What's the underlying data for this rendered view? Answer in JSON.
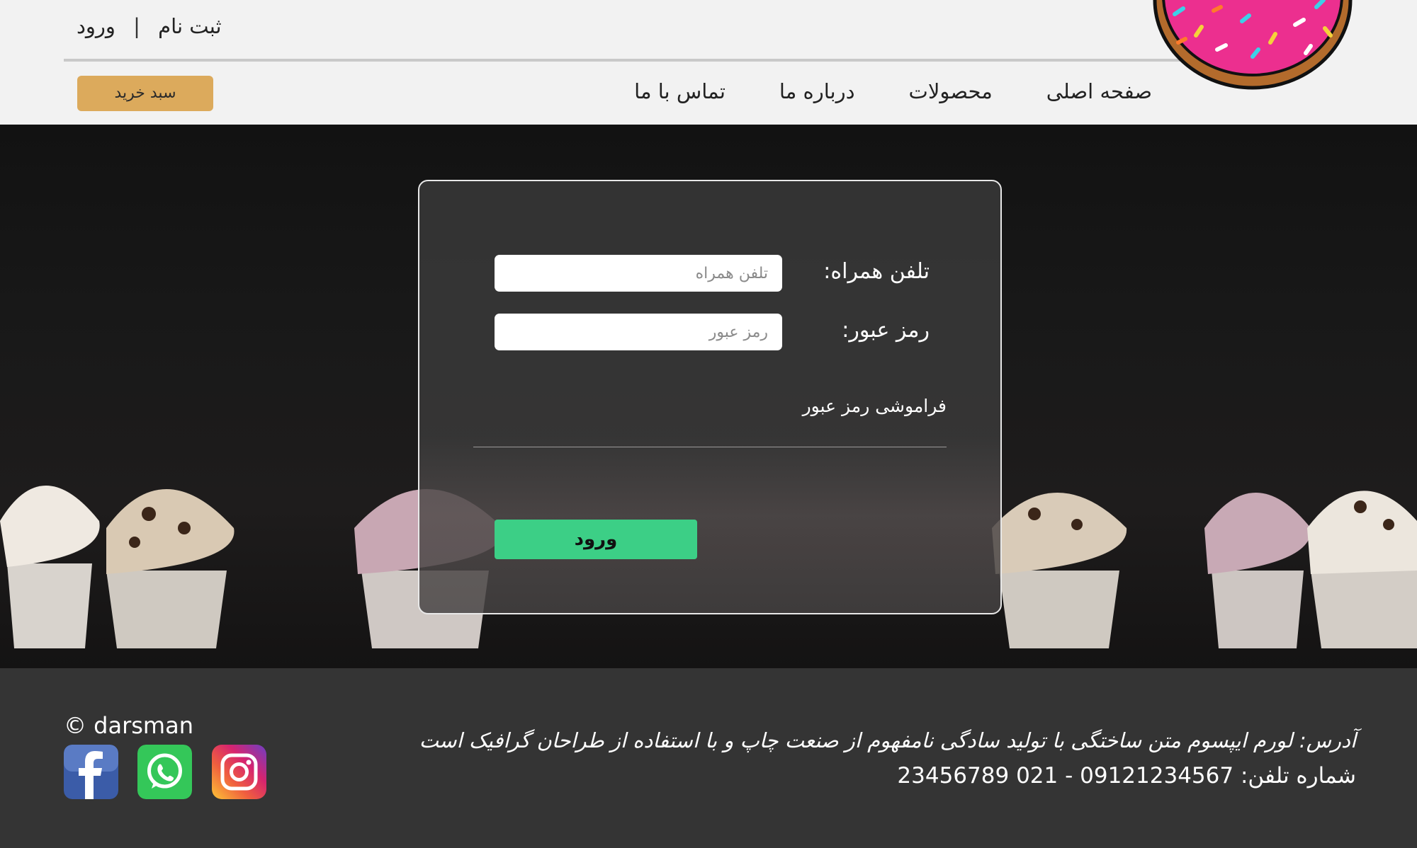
{
  "header": {
    "auth": {
      "register": "ثبت نام",
      "separator": "|",
      "login": "ورود"
    },
    "nav": [
      {
        "label": "صفحه اصلی",
        "name": "nav-home"
      },
      {
        "label": "محصولات",
        "name": "nav-products"
      },
      {
        "label": "درباره ما",
        "name": "nav-about"
      },
      {
        "label": "تماس با ما",
        "name": "nav-contact"
      }
    ],
    "cart_label": "سبد خرید",
    "logo_icon": "donut-logo-icon"
  },
  "login": {
    "phone_label": "تلفن همراه:",
    "phone_placeholder": "تلفن همراه",
    "phone_value": "",
    "password_label": "رمز عبور:",
    "password_placeholder": "رمز عبور",
    "password_value": "",
    "forgot_label": "فراموشی رمز عبور",
    "submit_label": "ورود"
  },
  "footer": {
    "copyright": "© darsman",
    "address": "آدرس: لورم ایپسوم متن ساختگی با تولید سادگی نامفهوم از صنعت چاپ و با استفاده از طراحان گرافیک است",
    "phone": "شماره تلفن: 09121234567 - 021 23456789",
    "social": [
      "facebook-icon",
      "whatsapp-icon",
      "instagram-icon"
    ]
  },
  "colors": {
    "header_bg": "#f2f2f2",
    "cart_button": "#dcaa5c",
    "login_button": "#3ccf86",
    "footer_bg": "#343434",
    "hero_bg": "#161616"
  }
}
